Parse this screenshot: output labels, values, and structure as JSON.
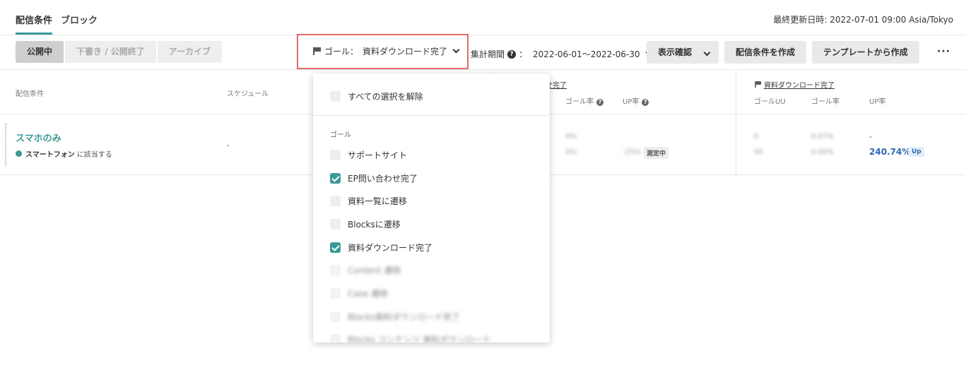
{
  "tabs": [
    {
      "label": "配信条件",
      "active": true
    },
    {
      "label": "ブロック",
      "active": false
    }
  ],
  "last_updated": "最終更新日時: 2022-07-01 09:00 Asia/Tokyo",
  "status_tabs": [
    "公開中",
    "下書き / 公開終了",
    "アーカイブ"
  ],
  "goal_filter": {
    "label": "ゴール：",
    "value": "資料ダウンロード完了"
  },
  "period": {
    "label": "集計期間",
    "colon": "：",
    "value": "2022-06-01〜2022-06-30"
  },
  "buttons": {
    "preview": "表示確認",
    "create": "配信条件を作成",
    "template": "テンプレートから作成",
    "more": "···"
  },
  "table": {
    "headers": {
      "condition": "配信条件",
      "schedule": "スケジュール",
      "goal1": "せ完了",
      "goal2": "資料ダウンロード完了",
      "goal_uu": "ゴールUU",
      "goal_rate": "ゴール率",
      "up_rate": "UP率"
    },
    "row": {
      "title": "スマホのみ",
      "segment_name": "スマートフォン",
      "segment_suffix": "に該当する",
      "schedule": "-",
      "g1_blur": [
        "0%",
        "0%",
        "-",
        "-25%"
      ],
      "g1_status": "測定中",
      "g2_blur": [
        "0",
        "0.07%",
        "00",
        "0.05%"
      ],
      "g2_dash": "-",
      "g2_up": "240.74%",
      "g2_up_badge": "Up"
    }
  },
  "dropdown": {
    "clear": "すべての選択を解除",
    "section": "ゴール",
    "items": [
      {
        "label": "サポートサイト",
        "checked": false
      },
      {
        "label": "EP問い合わせ完了",
        "checked": true
      },
      {
        "label": "資料一覧に遷移",
        "checked": false
      },
      {
        "label": "Blocksに遷移",
        "checked": false
      },
      {
        "label": "資料ダウンロード完了",
        "checked": true
      },
      {
        "label": "Content 遷移",
        "checked": false
      },
      {
        "label": "Case 遷移",
        "checked": false
      },
      {
        "label": "Blocks資料ダウンロード完了",
        "checked": false
      },
      {
        "label": "Blocks コンテンツ 資料ダウンロード",
        "checked": false
      }
    ]
  },
  "colors": {
    "accent": "#3a9a96",
    "highlight_border": "#e06a6a",
    "up": "#2b6cb0"
  }
}
